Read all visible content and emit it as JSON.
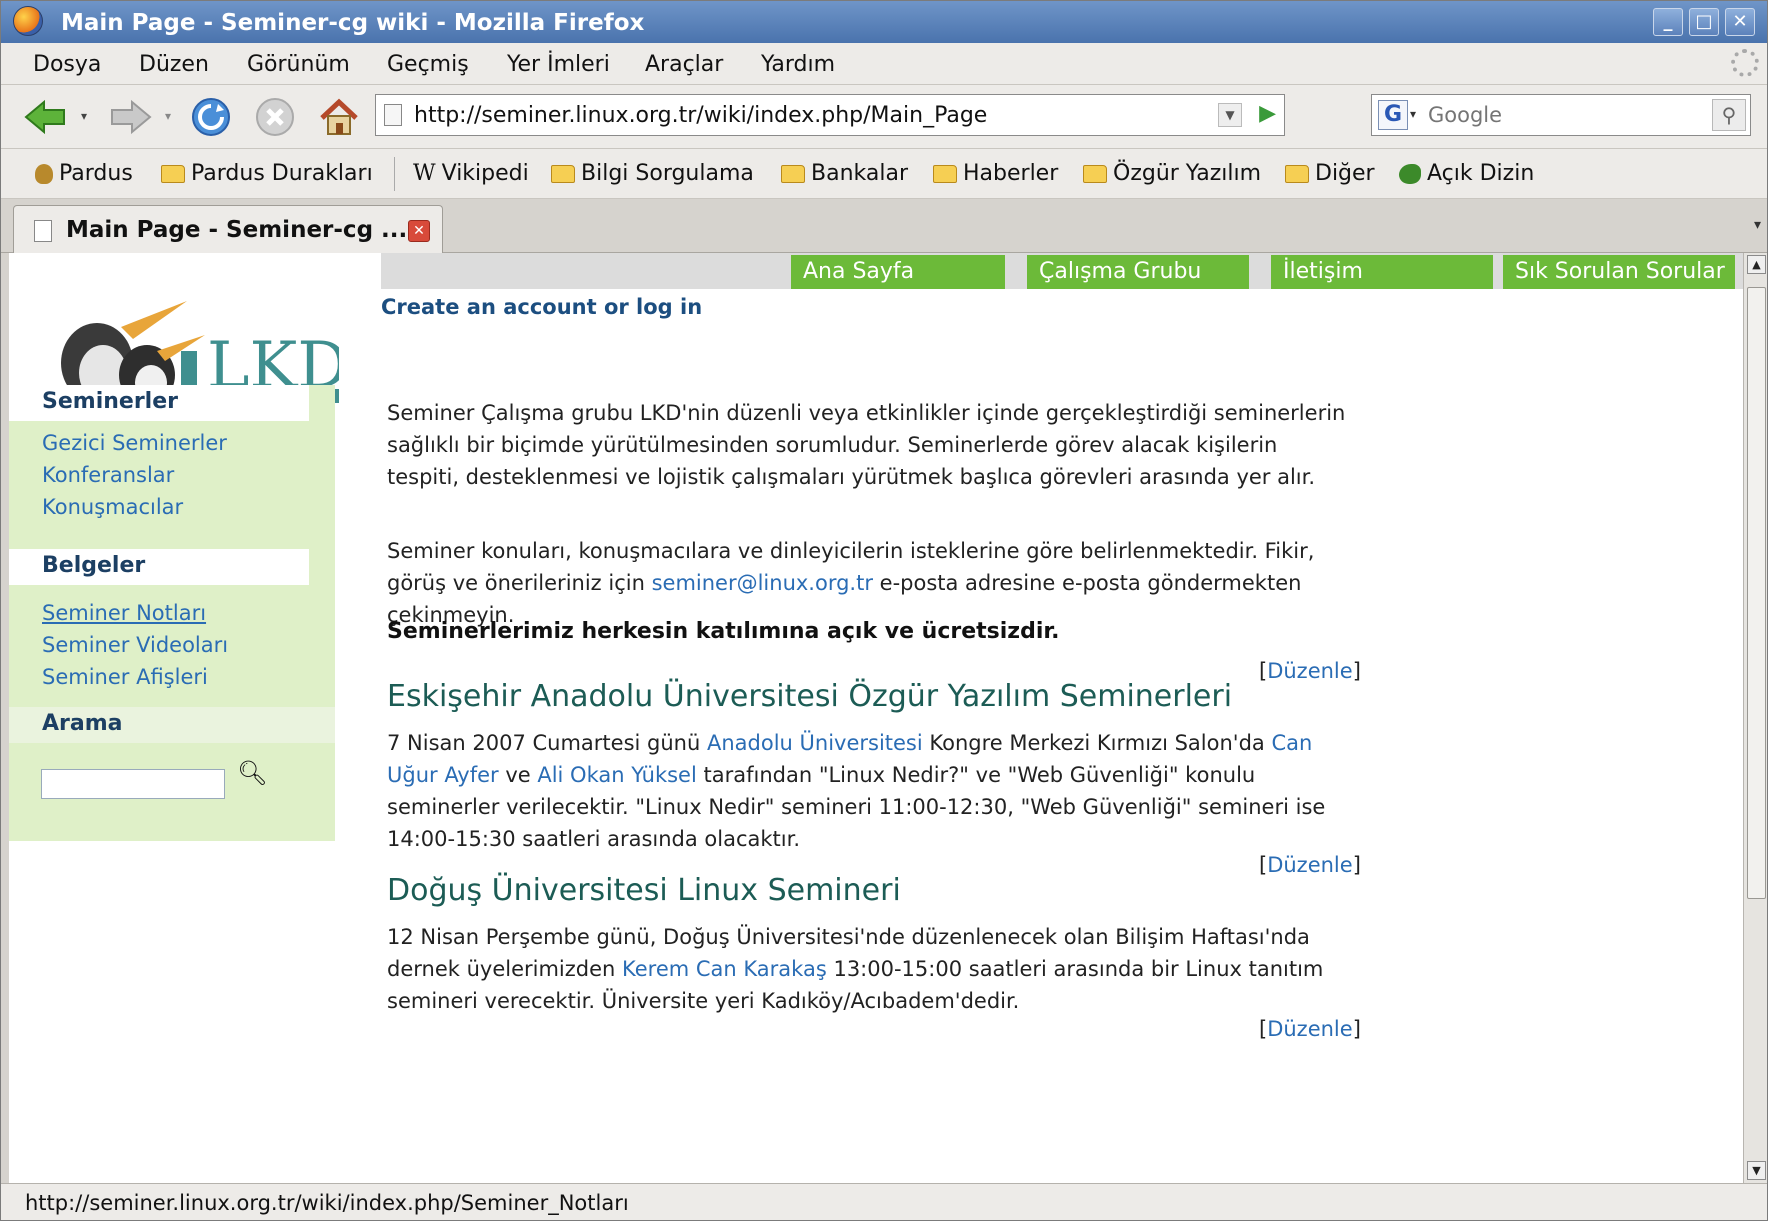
{
  "window": {
    "title": "Main Page - Seminer-cg wiki - Mozilla Firefox",
    "controls": {
      "minimize": "_",
      "maximize": "□",
      "close": "✕"
    }
  },
  "menu": {
    "items": [
      "Dosya",
      "Düzen",
      "Görünüm",
      "Geçmiş",
      "Yer İmleri",
      "Araçlar",
      "Yardım"
    ]
  },
  "nav": {
    "back_icon": "back-arrow-icon",
    "forward_icon": "forward-arrow-icon",
    "reload_icon": "reload-icon",
    "stop_icon": "stop-icon",
    "home_icon": "home-icon",
    "url": "http://seminer.linux.org.tr/wiki/index.php/Main_Page",
    "search_placeholder": "Google",
    "search_engine": "G"
  },
  "bookmarks": {
    "items": [
      "Pardus",
      "Pardus Durakları",
      "Vikipedi",
      "Bilgi Sorgulama",
      "Bankalar",
      "Haberler",
      "Özgür Yazılım",
      "Diğer",
      "Açık Dizin"
    ]
  },
  "tabs": {
    "active_label": "Main Page - Seminer-cg ..."
  },
  "site_nav": {
    "items": [
      "Ana Sayfa",
      "Çalışma Grubu",
      "İletişim",
      "Sık Sorulan Sorular"
    ],
    "color": "#6cba39"
  },
  "account": {
    "link": "Create an account or log in"
  },
  "logo": {
    "text": "LKD"
  },
  "sidebar": {
    "seminerler": {
      "title": "Seminerler",
      "links": [
        "Gezici Seminerler",
        "Konferanslar",
        "Konuşmacılar"
      ]
    },
    "belgeler": {
      "title": "Belgeler",
      "links": [
        "Seminer Notları",
        "Seminer Videoları",
        "Seminer Afişleri"
      ]
    },
    "arama": {
      "title": "Arama",
      "input_value": ""
    }
  },
  "content": {
    "intro": "Seminer Çalışma grubu LKD'nin düzenli veya etkinlikler içinde gerçekleştirdiği seminerlerin sağlıklı bir biçimde yürütülmesinden sorumludur. Seminerlerde görev alacak kişilerin tespiti, desteklenmesi ve lojistik çalışmaları yürütmek başlıca görevleri arasında yer alır.",
    "contact_before": "Seminer konuları, konuşmacılara ve dinleyicilerin isteklerine göre belirlenmektedir. Fikir, görüş ve önerileriniz için ",
    "contact_email": "seminer@linux.org.tr",
    "contact_after": " e-posta adresine e-posta göndermekten çekinmeyin.",
    "bold_note": "Seminerlerimiz herkesin katılımına açık ve ücretsizdir.",
    "edit_label": "Düzenle",
    "edit_open": "[",
    "edit_close": "]",
    "section1": {
      "heading": "Eskişehir Anadolu Üniversitesi Özgür Yazılım Seminerleri",
      "t1": "7 Nisan 2007 Cumartesi günü ",
      "link1": "Anadolu Üniversitesi",
      "t2": " Kongre Merkezi Kırmızı Salon'da ",
      "link2": "Can Uğur Ayfer",
      "t3": " ve ",
      "link3": "Ali Okan Yüksel",
      "t4": " tarafından \"Linux Nedir?\" ve \"Web Güvenliği\" konulu seminerler verilecektir. \"Linux Nedir\" semineri 11:00-12:30, \"Web Güvenliği\" semineri ise 14:00-15:30 saatleri arasında olacaktır."
    },
    "section2": {
      "heading": "Doğuş Üniversitesi Linux Semineri",
      "t1": "12 Nisan Perşembe günü, Doğuş Üniversitesi'nde düzenlenecek olan Bilişim Haftası'nda dernek üyelerimizden ",
      "link1": "Kerem Can Karakaş",
      "t2": " 13:00-15:00 saatleri arasında bir Linux tanıtım semineri verecektir. Üniversite yeri Kadıköy/Acıbadem'dedir."
    }
  },
  "status": {
    "text": "http://seminer.linux.org.tr/wiki/index.php/Seminer_Notları"
  }
}
